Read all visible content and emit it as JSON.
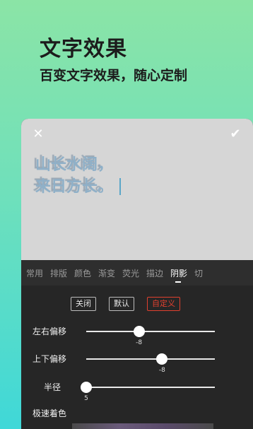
{
  "header": {
    "title": "文字效果",
    "subtitle": "百变文字效果，随心定制"
  },
  "editor": {
    "preview_text": [
      "山长水阔，",
      "来日方长。"
    ],
    "tabs": [
      {
        "label": "常用"
      },
      {
        "label": "排版"
      },
      {
        "label": "颜色"
      },
      {
        "label": "渐变"
      },
      {
        "label": "荧光"
      },
      {
        "label": "描边"
      },
      {
        "label": "阴影",
        "active": true
      },
      {
        "label": "切"
      }
    ],
    "shadow_buttons": {
      "off": "关闭",
      "default": "默认",
      "custom": "自定义"
    },
    "sliders": [
      {
        "label": "左右偏移",
        "value": "-8",
        "position": 0.41
      },
      {
        "label": "上下偏移",
        "value": "-8",
        "position": 0.59
      },
      {
        "label": "半径",
        "value": "5",
        "position": 0.0
      }
    ],
    "speed_color_label": "极速着色"
  },
  "colors": {
    "accent_red": "#e0402f",
    "preview_text": "#8fb0c8"
  }
}
